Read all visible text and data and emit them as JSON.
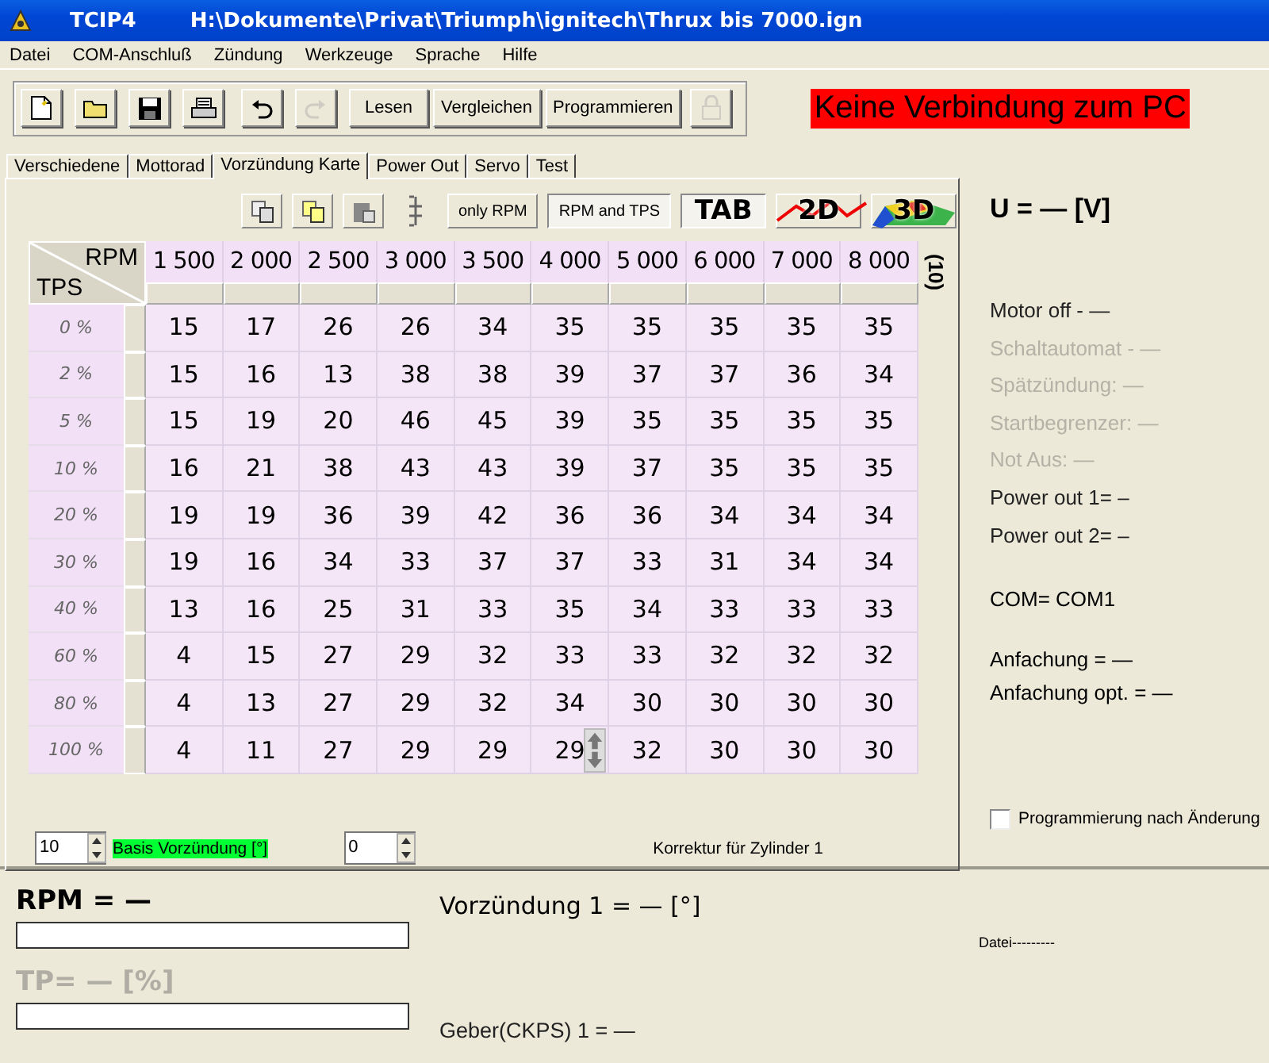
{
  "window": {
    "title": "TCIP4",
    "path": "H:\\Dokumente\\Privat\\Triumph\\ignitech\\Thrux bis 7000.ign"
  },
  "menu": [
    "Datei",
    "COM-Anschluß",
    "Zündung",
    "Werkzeuge",
    "Sprache",
    "Hilfe"
  ],
  "toolbar": [
    {
      "kind": "new",
      "disabled": false
    },
    {
      "kind": "open",
      "disabled": false
    },
    {
      "kind": "save",
      "disabled": false
    },
    {
      "kind": "print",
      "disabled": false
    },
    {
      "kind": "undo",
      "disabled": false
    },
    {
      "kind": "redo",
      "disabled": true
    },
    {
      "kind": "text",
      "label": "Lesen",
      "disabled": false
    },
    {
      "kind": "text",
      "label": "Vergleichen",
      "disabled": false
    },
    {
      "kind": "text",
      "label": "Programmieren",
      "disabled": false
    },
    {
      "kind": "lock",
      "disabled": true
    }
  ],
  "connection_status": "Keine Verbindung zum PC",
  "tabs": [
    {
      "label": "Verschiedene",
      "selected": false
    },
    {
      "label": "Mottorad",
      "selected": false
    },
    {
      "label": "Vorzündung Karte",
      "selected": true
    },
    {
      "label": "Power Out",
      "selected": false
    },
    {
      "label": "Servo",
      "selected": false
    },
    {
      "label": "Test",
      "selected": false
    }
  ],
  "map_toolbar": [
    {
      "kind": "copy"
    },
    {
      "kind": "duplicate"
    },
    {
      "kind": "paste"
    },
    {
      "kind": "column"
    },
    {
      "kind": "text",
      "label": "only RPM",
      "selected": false
    },
    {
      "kind": "text",
      "label": "RPM and TPS",
      "selected": true
    },
    {
      "kind": "tab",
      "label": "TAB",
      "selected": true
    },
    {
      "kind": "line",
      "label": "2D",
      "selected": false
    },
    {
      "kind": "surface",
      "label": "3D",
      "selected": false
    }
  ],
  "table": {
    "corner_top": "RPM",
    "corner_bottom": "TPS",
    "side_label": "(10)",
    "columns": [
      "1 500",
      "2 000",
      "2 500",
      "3 000",
      "3 500",
      "4 000",
      "5 000",
      "6 000",
      "7 000",
      "8 000"
    ],
    "rows": [
      {
        "tps": "0 %",
        "cells": [
          {
            "value": "15",
            "selected": false
          },
          {
            "value": "17",
            "selected": false
          },
          {
            "value": "26",
            "selected": false
          },
          {
            "value": "26",
            "selected": false
          },
          {
            "value": "34",
            "selected": false
          },
          {
            "value": "35",
            "selected": false
          },
          {
            "value": "35",
            "selected": false
          },
          {
            "value": "35",
            "selected": false
          },
          {
            "value": "35",
            "selected": false
          },
          {
            "value": "35",
            "selected": false
          }
        ]
      },
      {
        "tps": "2 %",
        "cells": [
          {
            "value": "15",
            "selected": false
          },
          {
            "value": "16",
            "selected": false
          },
          {
            "value": "13",
            "selected": false
          },
          {
            "value": "38",
            "selected": false
          },
          {
            "value": "38",
            "selected": false
          },
          {
            "value": "39",
            "selected": false
          },
          {
            "value": "37",
            "selected": false
          },
          {
            "value": "37",
            "selected": false
          },
          {
            "value": "36",
            "selected": false
          },
          {
            "value": "34",
            "selected": false
          }
        ]
      },
      {
        "tps": "5 %",
        "cells": [
          {
            "value": "15",
            "selected": false
          },
          {
            "value": "19",
            "selected": false
          },
          {
            "value": "20",
            "selected": false
          },
          {
            "value": "46",
            "selected": false
          },
          {
            "value": "45",
            "selected": false
          },
          {
            "value": "39",
            "selected": false
          },
          {
            "value": "35",
            "selected": false
          },
          {
            "value": "35",
            "selected": false
          },
          {
            "value": "35",
            "selected": false
          },
          {
            "value": "35",
            "selected": false
          }
        ]
      },
      {
        "tps": "10 %",
        "cells": [
          {
            "value": "16",
            "selected": false
          },
          {
            "value": "21",
            "selected": false
          },
          {
            "value": "38",
            "selected": false
          },
          {
            "value": "43",
            "selected": false
          },
          {
            "value": "43",
            "selected": false
          },
          {
            "value": "39",
            "selected": false
          },
          {
            "value": "37",
            "selected": false
          },
          {
            "value": "35",
            "selected": false
          },
          {
            "value": "35",
            "selected": false
          },
          {
            "value": "35",
            "selected": false
          }
        ]
      },
      {
        "tps": "20 %",
        "cells": [
          {
            "value": "19",
            "selected": false
          },
          {
            "value": "19",
            "selected": false
          },
          {
            "value": "36",
            "selected": false
          },
          {
            "value": "39",
            "selected": false
          },
          {
            "value": "42",
            "selected": false
          },
          {
            "value": "36",
            "selected": false
          },
          {
            "value": "36",
            "selected": false
          },
          {
            "value": "34",
            "selected": false
          },
          {
            "value": "34",
            "selected": false
          },
          {
            "value": "34",
            "selected": false
          }
        ]
      },
      {
        "tps": "30 %",
        "cells": [
          {
            "value": "19",
            "selected": false
          },
          {
            "value": "16",
            "selected": false
          },
          {
            "value": "34",
            "selected": false
          },
          {
            "value": "33",
            "selected": false
          },
          {
            "value": "37",
            "selected": false
          },
          {
            "value": "37",
            "selected": false
          },
          {
            "value": "33",
            "selected": false
          },
          {
            "value": "31",
            "selected": false
          },
          {
            "value": "34",
            "selected": false
          },
          {
            "value": "34",
            "selected": false
          }
        ]
      },
      {
        "tps": "40 %",
        "cells": [
          {
            "value": "13",
            "selected": false
          },
          {
            "value": "16",
            "selected": false
          },
          {
            "value": "25",
            "selected": false
          },
          {
            "value": "31",
            "selected": false
          },
          {
            "value": "33",
            "selected": false
          },
          {
            "value": "35",
            "selected": false
          },
          {
            "value": "34",
            "selected": false
          },
          {
            "value": "33",
            "selected": false
          },
          {
            "value": "33",
            "selected": false
          },
          {
            "value": "33",
            "selected": false
          }
        ]
      },
      {
        "tps": "60 %",
        "cells": [
          {
            "value": "4",
            "selected": false
          },
          {
            "value": "15",
            "selected": false
          },
          {
            "value": "27",
            "selected": false
          },
          {
            "value": "29",
            "selected": false
          },
          {
            "value": "32",
            "selected": false
          },
          {
            "value": "33",
            "selected": false
          },
          {
            "value": "33",
            "selected": false
          },
          {
            "value": "32",
            "selected": false
          },
          {
            "value": "32",
            "selected": false
          },
          {
            "value": "32",
            "selected": false
          }
        ]
      },
      {
        "tps": "80 %",
        "cells": [
          {
            "value": "4",
            "selected": false
          },
          {
            "value": "13",
            "selected": false
          },
          {
            "value": "27",
            "selected": false
          },
          {
            "value": "29",
            "selected": false
          },
          {
            "value": "32",
            "selected": false
          },
          {
            "value": "34",
            "selected": false
          },
          {
            "value": "30",
            "selected": false
          },
          {
            "value": "30",
            "selected": false
          },
          {
            "value": "30",
            "selected": false
          },
          {
            "value": "30",
            "selected": false
          }
        ]
      },
      {
        "tps": "100 %",
        "cells": [
          {
            "value": "4",
            "selected": false
          },
          {
            "value": "11",
            "selected": false
          },
          {
            "value": "27",
            "selected": false
          },
          {
            "value": "29",
            "selected": false
          },
          {
            "value": "29",
            "selected": false
          },
          {
            "value": "29",
            "selected": true
          },
          {
            "value": "32",
            "selected": false
          },
          {
            "value": "30",
            "selected": false
          },
          {
            "value": "30",
            "selected": false
          },
          {
            "value": "30",
            "selected": false
          }
        ]
      }
    ]
  },
  "base_advance": {
    "value": "10",
    "label": "Basis Vorzündung [°]"
  },
  "cylinder_correction": {
    "value": "0",
    "label": "Korrektur für Zylinder 1"
  },
  "voltage": "U = — [V]",
  "status_lines": [
    {
      "text": "Motor off - —",
      "disabled": false
    },
    {
      "text": "Schaltautomat - —",
      "disabled": true
    },
    {
      "text": "Spätzündung: —",
      "disabled": true
    },
    {
      "text": "Startbegrenzer: —",
      "disabled": true
    },
    {
      "text": "Not Aus: —",
      "disabled": true
    },
    {
      "text": "Power out 1= –",
      "disabled": false
    },
    {
      "text": "Power out 2= –",
      "disabled": false
    }
  ],
  "com": "COM= COM1",
  "gain": [
    "Anfachung = —",
    "Anfachung opt. = —"
  ],
  "program_after_change": {
    "label": "Programmierung nach Änderung",
    "checked": false
  },
  "rpm": {
    "label": "RPM = —",
    "level": 0,
    "disabled": false
  },
  "tp": {
    "label": "TP= — [%]",
    "level": 0,
    "disabled": true
  },
  "advance": "Vorzündung 1 = — [°]",
  "sensor": "Geber(CKPS) 1 = —",
  "file": "Datei---------"
}
